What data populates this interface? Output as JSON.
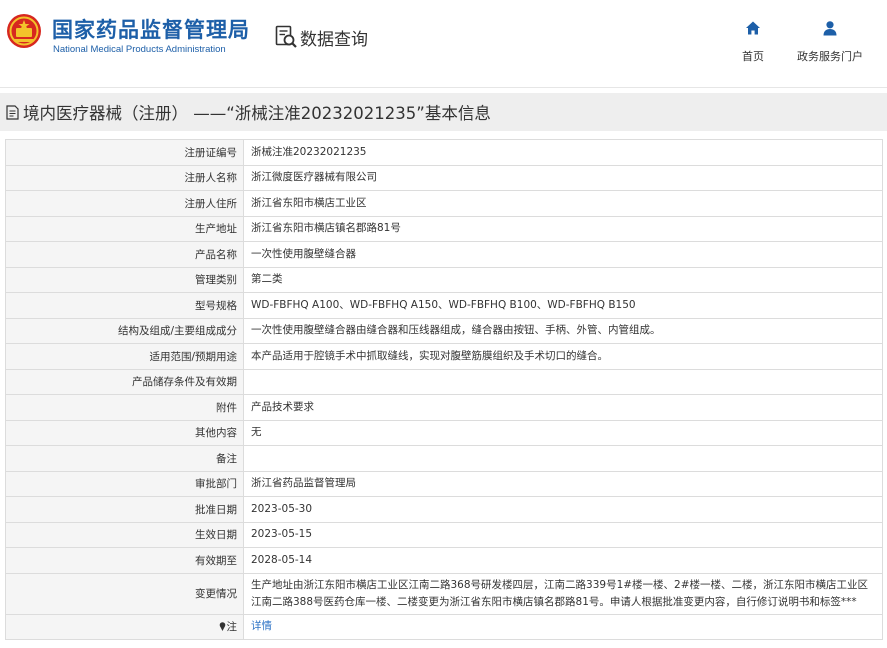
{
  "header": {
    "brand_cn": "国家药品监督管理局",
    "brand_en": "National Medical Products Administration",
    "section_title": "数据查询",
    "nav": [
      {
        "label": "首页",
        "icon": "home-icon"
      },
      {
        "label": "政务服务门户",
        "icon": "user-icon"
      }
    ]
  },
  "page": {
    "title": "境内医疗器械（注册） ——“浙械注准20232021235”基本信息"
  },
  "colors": {
    "brand_blue": "#1d5fa8",
    "link_blue": "#2f74c6",
    "title_bar_bg": "#eeeeee",
    "label_bg": "#f5f5f5",
    "logo_red": "#d7271f",
    "logo_gold": "#f3c22b"
  },
  "rows": [
    {
      "label": "注册证编号",
      "value": "浙械注准20232021235"
    },
    {
      "label": "注册人名称",
      "value": "浙江微度医疗器械有限公司"
    },
    {
      "label": "注册人住所",
      "value": "浙江省东阳市横店工业区"
    },
    {
      "label": "生产地址",
      "value": "浙江省东阳市横店镇名郡路81号"
    },
    {
      "label": "产品名称",
      "value": "一次性使用腹壁缝合器"
    },
    {
      "label": "管理类别",
      "value": "第二类"
    },
    {
      "label": "型号规格",
      "value": "WD-FBFHQ A100、WD-FBFHQ A150、WD-FBFHQ B100、WD-FBFHQ B150"
    },
    {
      "label": "结构及组成/主要组成成分",
      "value": "一次性使用腹壁缝合器由缝合器和压线器组成，缝合器由按钮、手柄、外管、内管组成。"
    },
    {
      "label": "适用范围/预期用途",
      "value": "本产品适用于腔镜手术中抓取缝线，实现对腹壁筋膜组织及手术切口的缝合。"
    },
    {
      "label": "产品储存条件及有效期",
      "value": ""
    },
    {
      "label": "附件",
      "value": "产品技术要求"
    },
    {
      "label": "其他内容",
      "value": "无"
    },
    {
      "label": "备注",
      "value": ""
    },
    {
      "label": "审批部门",
      "value": "浙江省药品监督管理局"
    },
    {
      "label": "批准日期",
      "value": "2023-05-30"
    },
    {
      "label": "生效日期",
      "value": "2023-05-15"
    },
    {
      "label": "有效期至",
      "value": "2028-05-14"
    },
    {
      "label": "变更情况",
      "value": "生产地址由浙江东阳市横店工业区江南二路368号研发楼四层，江南二路339号1#楼一楼、2#楼一楼、二楼，浙江东阳市横店工业区江南二路388号医药仓库一楼、二楼变更为浙江省东阳市横店镇名郡路81号。申请人根据批准变更内容，自行修订说明书和标签***"
    }
  ],
  "note": {
    "label": "注",
    "link_text": "详情",
    "icon": "pin-icon"
  }
}
